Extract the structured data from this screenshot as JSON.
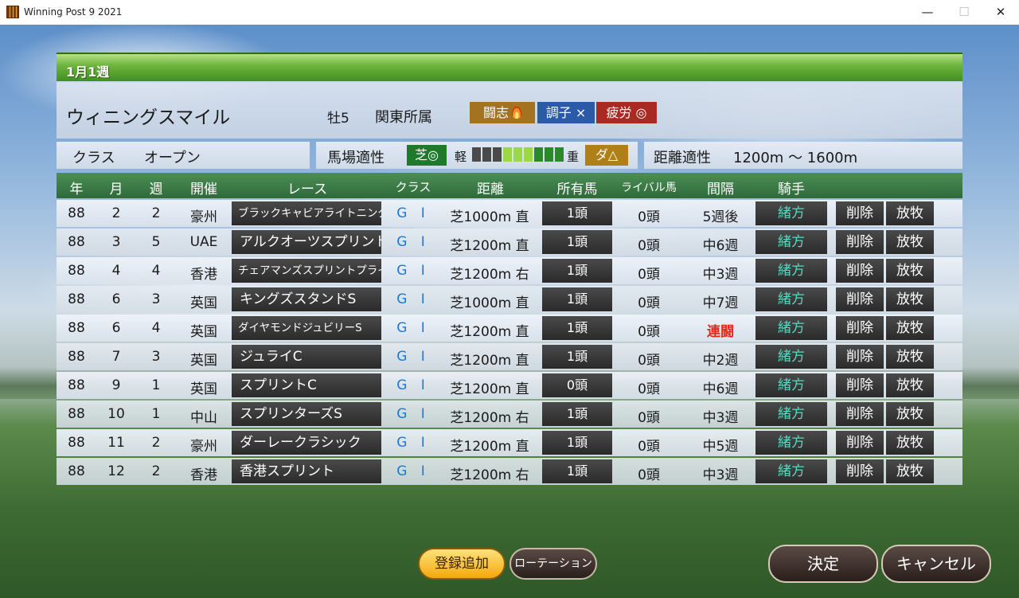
{
  "window": {
    "title": "Winning Post 9 2021",
    "minimize": "—",
    "maximize": "☐",
    "close": "✕"
  },
  "header": {
    "date": "1月1週"
  },
  "horse": {
    "name": "ウィニングスマイル",
    "sex_age": "牡5",
    "affiliation": "関東所属",
    "tags": {
      "fight": "闘志",
      "condition": "調子 ×",
      "fatigue": "疲労 ◎"
    },
    "class_label": "クラス",
    "class_value": "オープン",
    "surface_label": "馬場適性",
    "turf": "芝◎",
    "light_label": "軽",
    "heavy_label": "重",
    "dirt": "ダ△",
    "gauge_level": 6,
    "gauge_total": 9,
    "distance_label": "距離適性",
    "distance_value": "1200m 〜 1600m"
  },
  "colors": {
    "gauge_empty": "#4a4a4a",
    "gauge_light": "#9ad84a",
    "gauge_full": "#2a8a2a",
    "rival_alert": "#e02a1a",
    "jockey": "#58d8c0",
    "grade": "#1a7ad6"
  },
  "table": {
    "headers": {
      "year": "年",
      "month": "月",
      "week": "週",
      "venue": "開催",
      "race": "レース",
      "class": "クラス",
      "distance": "距離",
      "owned": "所有馬",
      "rival": "ライバル馬",
      "interval": "間隔",
      "jockey": "騎手"
    },
    "rows": [
      {
        "year": "88",
        "month": "2",
        "week": "2",
        "venue": "豪州",
        "race": "ブラックキャビアライトニング",
        "grade": "G I",
        "distance": "芝1000m 直",
        "owned": "1頭",
        "rival": "0頭",
        "interval": "5週後",
        "jockey": "緒方",
        "delete": "削除",
        "release": "放牧"
      },
      {
        "year": "88",
        "month": "3",
        "week": "5",
        "venue": "UAE",
        "race": "アルクオーツスプリント",
        "grade": "G I",
        "distance": "芝1200m 直",
        "owned": "1頭",
        "rival": "0頭",
        "interval": "中6週",
        "jockey": "緒方",
        "delete": "削除",
        "release": "放牧"
      },
      {
        "year": "88",
        "month": "4",
        "week": "4",
        "venue": "香港",
        "race": "チェアマンズスプリントプライズ",
        "grade": "G I",
        "distance": "芝1200m 右",
        "owned": "1頭",
        "rival": "0頭",
        "interval": "中3週",
        "jockey": "緒方",
        "delete": "削除",
        "release": "放牧"
      },
      {
        "year": "88",
        "month": "6",
        "week": "3",
        "venue": "英国",
        "race": "キングズスタンドS",
        "grade": "G I",
        "distance": "芝1000m 直",
        "owned": "1頭",
        "rival": "0頭",
        "interval": "中7週",
        "jockey": "緒方",
        "delete": "削除",
        "release": "放牧"
      },
      {
        "year": "88",
        "month": "6",
        "week": "4",
        "venue": "英国",
        "race": "ダイヤモンドジュビリーS",
        "grade": "G I",
        "distance": "芝1200m 直",
        "owned": "1頭",
        "rival": "0頭",
        "interval": "連闘",
        "jockey": "緒方",
        "delete": "削除",
        "release": "放牧"
      },
      {
        "year": "88",
        "month": "7",
        "week": "3",
        "venue": "英国",
        "race": "ジュライC",
        "grade": "G I",
        "distance": "芝1200m 直",
        "owned": "1頭",
        "rival": "0頭",
        "interval": "中2週",
        "jockey": "緒方",
        "delete": "削除",
        "release": "放牧"
      },
      {
        "year": "88",
        "month": "9",
        "week": "1",
        "venue": "英国",
        "race": "スプリントC",
        "grade": "G I",
        "distance": "芝1200m 直",
        "owned": "0頭",
        "rival": "0頭",
        "interval": "中6週",
        "jockey": "緒方",
        "delete": "削除",
        "release": "放牧"
      },
      {
        "year": "88",
        "month": "10",
        "week": "1",
        "venue": "中山",
        "race": "スプリンターズS",
        "grade": "G I",
        "distance": "芝1200m 右",
        "owned": "1頭",
        "rival": "0頭",
        "interval": "中3週",
        "jockey": "緒方",
        "delete": "削除",
        "release": "放牧"
      },
      {
        "year": "88",
        "month": "11",
        "week": "2",
        "venue": "豪州",
        "race": "ダーレークラシック",
        "grade": "G I",
        "distance": "芝1200m 直",
        "owned": "1頭",
        "rival": "0頭",
        "interval": "中5週",
        "jockey": "緒方",
        "delete": "削除",
        "release": "放牧"
      },
      {
        "year": "88",
        "month": "12",
        "week": "2",
        "venue": "香港",
        "race": "香港スプリント",
        "grade": "G I",
        "distance": "芝1200m 右",
        "owned": "1頭",
        "rival": "0頭",
        "interval": "中3週",
        "jockey": "緒方",
        "delete": "削除",
        "release": "放牧"
      }
    ]
  },
  "buttons": {
    "add": "登録追加",
    "rotation": "ローテーション",
    "confirm": "決定",
    "cancel": "キャンセル"
  }
}
